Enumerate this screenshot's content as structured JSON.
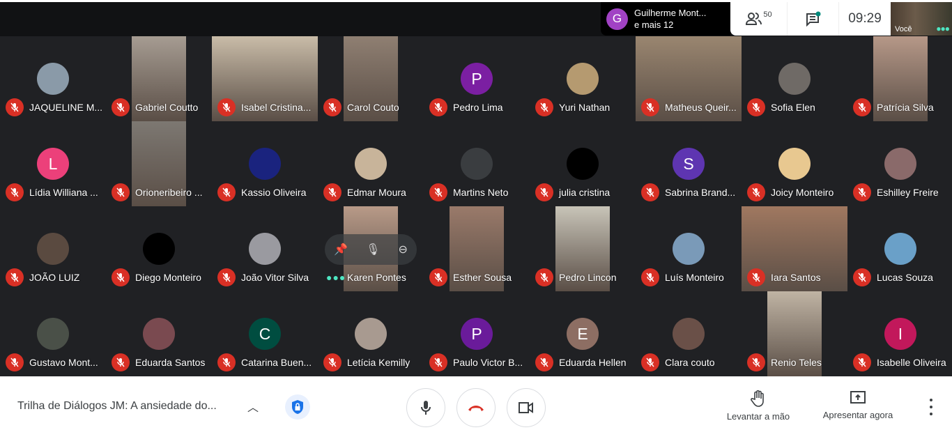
{
  "header": {
    "speaker_initial": "G",
    "speaker_name": "Guilherme Mont...",
    "speaker_more": "e mais 12",
    "participant_count": "50",
    "time": "09:29",
    "self_label": "Você",
    "speaker_color": "#a142c4"
  },
  "participants": [
    {
      "name": "JAQUELINE M...",
      "kind": "photo",
      "color": "#8a9aa8"
    },
    {
      "name": "Gabriel Coutto",
      "kind": "video",
      "color": "#a69c92"
    },
    {
      "name": "Isabel Cristina...",
      "kind": "video",
      "color": "#c9bca8",
      "full": true
    },
    {
      "name": "Carol Couto",
      "kind": "video",
      "color": "#8f7f72"
    },
    {
      "name": "Pedro Lima",
      "kind": "letter",
      "letter": "P",
      "color": "#7b1fa2"
    },
    {
      "name": "Yuri Nathan",
      "kind": "photo",
      "color": "#b59a70"
    },
    {
      "name": "Matheus Queir...",
      "kind": "video",
      "color": "#9a8670",
      "full": true
    },
    {
      "name": "Sofia Elen",
      "kind": "photo",
      "color": "#6f6a66"
    },
    {
      "name": "Patrícia Silva",
      "kind": "video",
      "color": "#b69888"
    },
    {
      "name": "Lídia Williana ...",
      "kind": "letter",
      "letter": "L",
      "color": "#ec407a"
    },
    {
      "name": "Orioneribeiro ...",
      "kind": "video",
      "color": "#7d7872"
    },
    {
      "name": "Kassio Oliveira",
      "kind": "photo",
      "color": "#1a237e"
    },
    {
      "name": "Edmar Moura",
      "kind": "photo",
      "color": "#c8b49a"
    },
    {
      "name": "Martins Neto",
      "kind": "photo",
      "color": "#3a3d40"
    },
    {
      "name": "julia cristina",
      "kind": "photo",
      "color": "#000000"
    },
    {
      "name": "Sabrina Brand...",
      "kind": "letter",
      "letter": "S",
      "color": "#5e35b1"
    },
    {
      "name": "Joicy Monteiro",
      "kind": "photo",
      "color": "#e8c890"
    },
    {
      "name": "Eshilley Freire",
      "kind": "photo",
      "color": "#8a6a6a"
    },
    {
      "name": "JOÃO LUIZ",
      "kind": "photo",
      "color": "#5a4a40"
    },
    {
      "name": "Diego Monteiro",
      "kind": "photo",
      "color": "#000000"
    },
    {
      "name": "João Vitor Silva",
      "kind": "photo",
      "color": "#9a9aa0"
    },
    {
      "name": "Karen Pontes",
      "kind": "video",
      "color": "#b89a88",
      "hover": true
    },
    {
      "name": "Esther Sousa",
      "kind": "video",
      "color": "#9a7a6a"
    },
    {
      "name": "Pedro Lincon",
      "kind": "video",
      "color": "#c8c4b8"
    },
    {
      "name": "Luís Monteiro",
      "kind": "photo",
      "color": "#7a9ab8"
    },
    {
      "name": "Iara Santos",
      "kind": "video",
      "color": "#a07860",
      "full": true
    },
    {
      "name": "Lucas Souza",
      "kind": "photo",
      "color": "#6aa0c8"
    },
    {
      "name": "Gustavo Mont...",
      "kind": "photo",
      "color": "#4a5048"
    },
    {
      "name": "Eduarda Santos",
      "kind": "photo",
      "color": "#7a4a50"
    },
    {
      "name": "Catarina Buen...",
      "kind": "letter",
      "letter": "C",
      "color": "#004d40"
    },
    {
      "name": "Letícia Kemilly",
      "kind": "photo",
      "color": "#a89a90"
    },
    {
      "name": "Paulo Victor B...",
      "kind": "letter",
      "letter": "P",
      "color": "#6a1b9a"
    },
    {
      "name": "Eduarda Hellen",
      "kind": "letter",
      "letter": "E",
      "color": "#8d6e63"
    },
    {
      "name": "Clara couto",
      "kind": "photo",
      "color": "#6a5048"
    },
    {
      "name": "Renio Teles",
      "kind": "video",
      "color": "#c0b4a4"
    },
    {
      "name": "Isabelle Oliveira",
      "kind": "letter",
      "letter": "I",
      "color": "#c2185b"
    }
  ],
  "footer": {
    "meeting_title": "Trilha de Diálogos JM: A ansiedade do...",
    "raise_hand": "Levantar a mão",
    "present_now": "Apresentar agora",
    "hangup_color": "#d93025"
  }
}
